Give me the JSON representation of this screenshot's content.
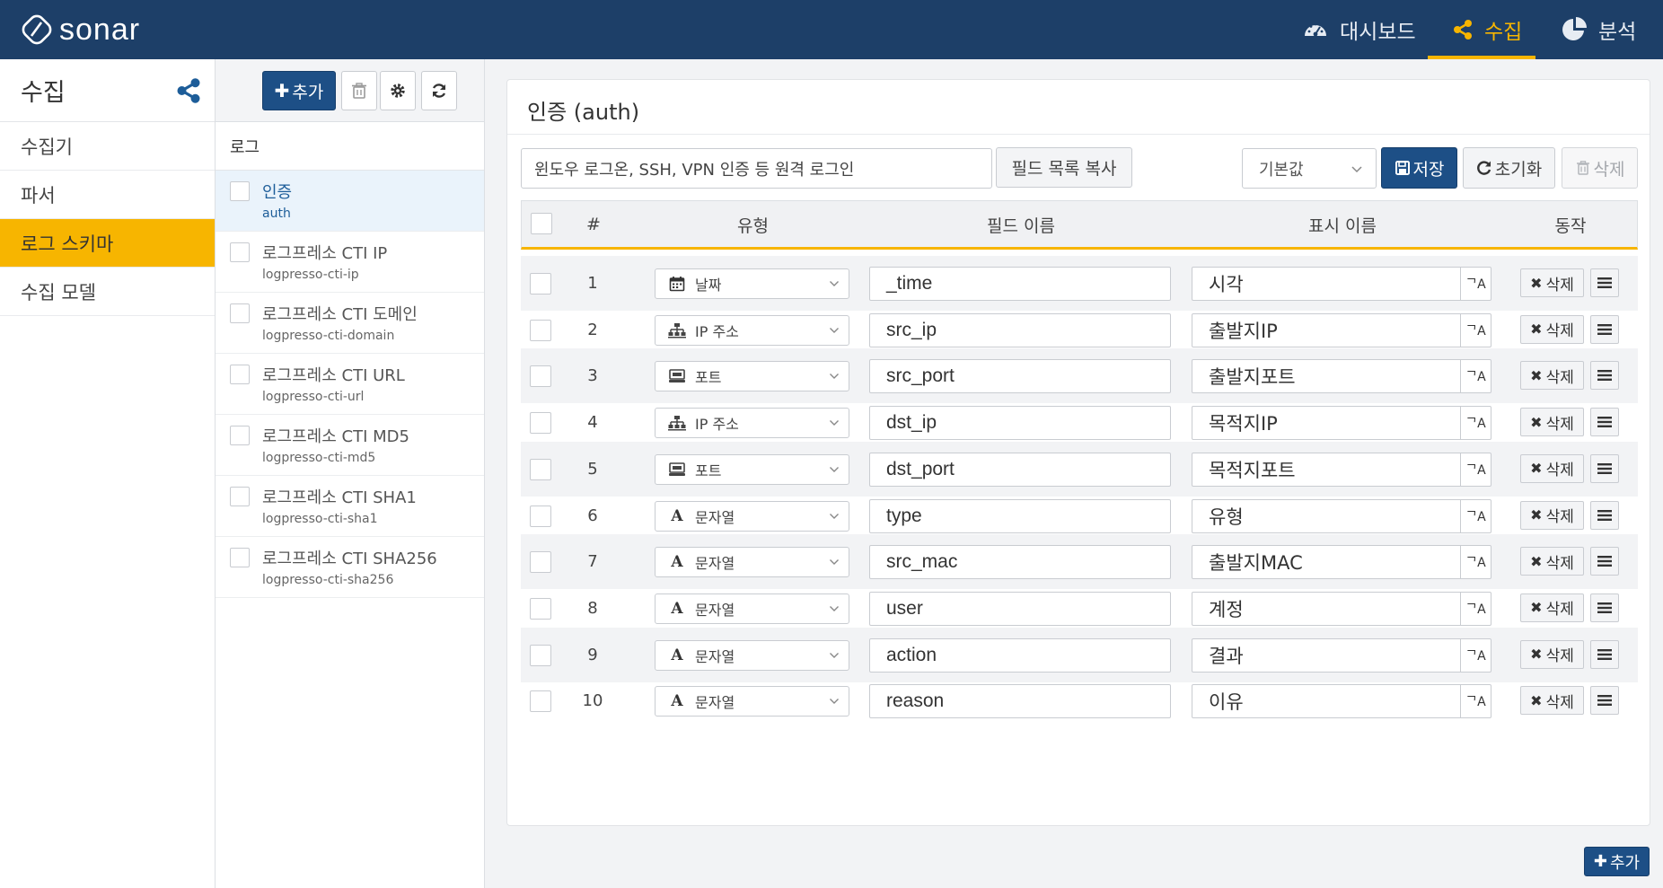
{
  "app": {
    "logo_text": "sonar"
  },
  "topnav": {
    "items": [
      {
        "label": "대시보드",
        "icon": "dashboard-icon"
      },
      {
        "label": "수집",
        "icon": "share-icon",
        "active": true
      },
      {
        "label": "분석",
        "icon": "pie-chart-icon"
      }
    ]
  },
  "sidebar": {
    "title": "수집",
    "items": [
      {
        "label": "수집기"
      },
      {
        "label": "파서"
      },
      {
        "label": "로그 스키마",
        "active": true
      },
      {
        "label": "수집 모델"
      }
    ]
  },
  "loglist": {
    "add_label": "추가",
    "header": "로그",
    "items": [
      {
        "name": "인증",
        "code": "auth",
        "active": true
      },
      {
        "name": "로그프레소 CTI IP",
        "code": "logpresso-cti-ip"
      },
      {
        "name": "로그프레소 CTI 도메인",
        "code": "logpresso-cti-domain"
      },
      {
        "name": "로그프레소 CTI URL",
        "code": "logpresso-cti-url"
      },
      {
        "name": "로그프레소 CTI MD5",
        "code": "logpresso-cti-md5"
      },
      {
        "name": "로그프레소 CTI SHA1",
        "code": "logpresso-cti-sha1"
      },
      {
        "name": "로그프레소 CTI SHA256",
        "code": "logpresso-cti-sha256"
      }
    ]
  },
  "detail": {
    "title": "인증 (auth)",
    "description": "윈도우 로그온, SSH, VPN 인증 등 원격 로그인",
    "copy_fields_label": "필드 목록 복사",
    "default_select": "기본값",
    "save_label": "저장",
    "reset_label": "초기화",
    "delete_label": "삭제",
    "columns": {
      "num": "#",
      "type": "유형",
      "field_name": "필드 이름",
      "display_name": "표시 이름",
      "action": "동작"
    },
    "rows": [
      {
        "num": "1",
        "type": "날짜",
        "type_icon": "calendar-icon",
        "field": "_time",
        "display": "시각"
      },
      {
        "num": "2",
        "type": "IP 주소",
        "type_icon": "sitemap-icon",
        "field": "src_ip",
        "display": "출발지IP"
      },
      {
        "num": "3",
        "type": "포트",
        "type_icon": "port-icon",
        "field": "src_port",
        "display": "출발지포트"
      },
      {
        "num": "4",
        "type": "IP 주소",
        "type_icon": "sitemap-icon",
        "field": "dst_ip",
        "display": "목적지IP"
      },
      {
        "num": "5",
        "type": "포트",
        "type_icon": "port-icon",
        "field": "dst_port",
        "display": "목적지포트"
      },
      {
        "num": "6",
        "type": "문자열",
        "type_icon": "text-icon",
        "field": "type",
        "display": "유형"
      },
      {
        "num": "7",
        "type": "문자열",
        "type_icon": "text-icon",
        "field": "src_mac",
        "display": "출발지MAC"
      },
      {
        "num": "8",
        "type": "문자열",
        "type_icon": "text-icon",
        "field": "user",
        "display": "계정"
      },
      {
        "num": "9",
        "type": "문자열",
        "type_icon": "text-icon",
        "field": "action",
        "display": "결과"
      },
      {
        "num": "10",
        "type": "문자열",
        "type_icon": "text-icon",
        "field": "reason",
        "display": "이유"
      }
    ],
    "row_delete_label": "삭제",
    "add_label": "추가"
  },
  "colors": {
    "nav_bg": "#1d3f68",
    "accent": "#f7b500",
    "primary_button": "#1d4f86"
  }
}
